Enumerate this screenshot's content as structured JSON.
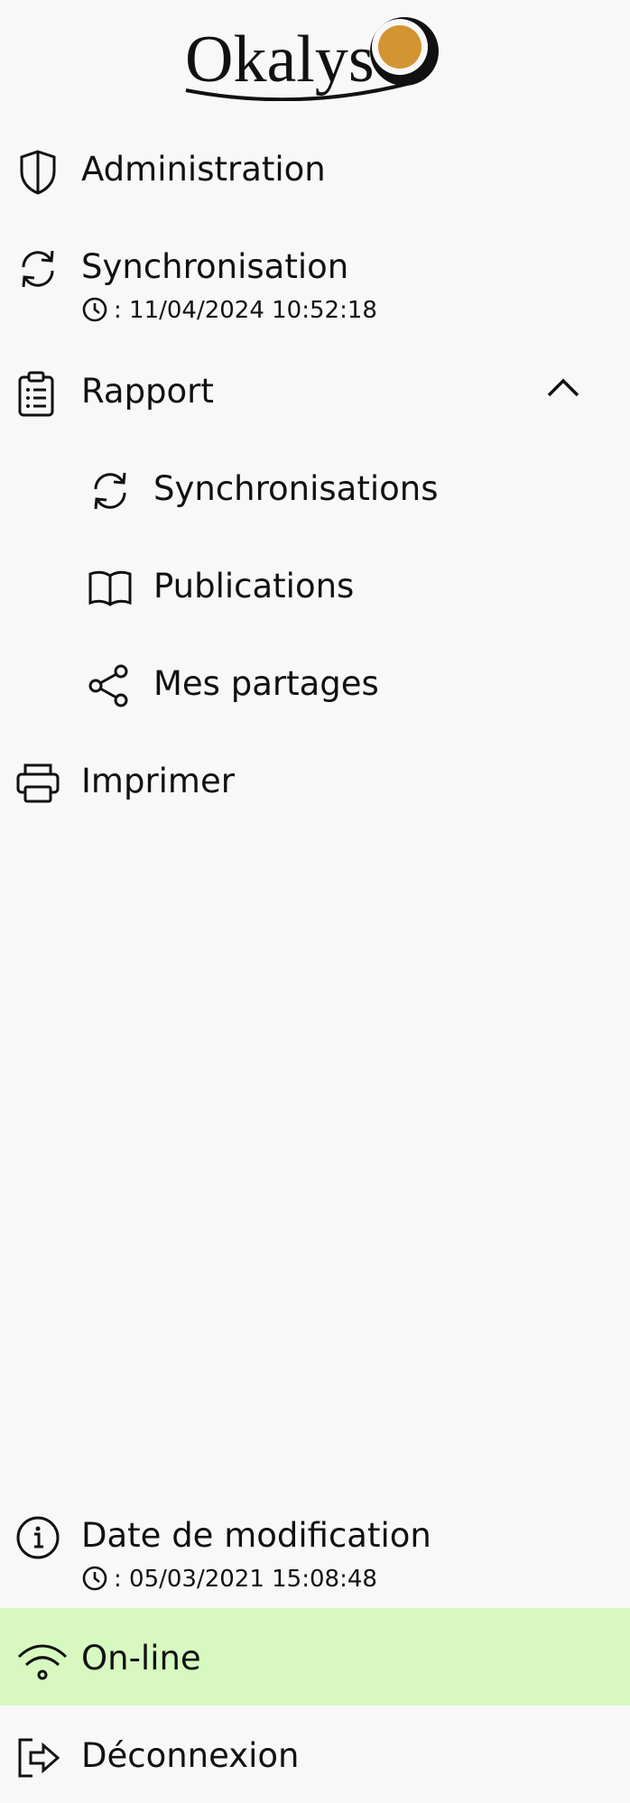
{
  "logo": {
    "text": "Okalys",
    "accent_color": "#d39432"
  },
  "menu": {
    "administration": "Administration",
    "synchronisation": "Synchronisation",
    "synchronisation_meta": ": 11/04/2024 10:52:18",
    "rapport": "Rapport",
    "rapport_expanded": true,
    "rapport_items": [
      {
        "label": "Synchronisations",
        "icon": "sync-icon"
      },
      {
        "label": "Publications",
        "icon": "book-icon"
      },
      {
        "label": "Mes partages",
        "icon": "share-icon"
      }
    ],
    "imprimer": "Imprimer"
  },
  "footer": {
    "date_modification": "Date de modification",
    "date_meta": ": 05/03/2021 15:08:48",
    "online": "On-line",
    "online_color": "#d7f9c0",
    "deconnexion": "Déconnexion"
  }
}
